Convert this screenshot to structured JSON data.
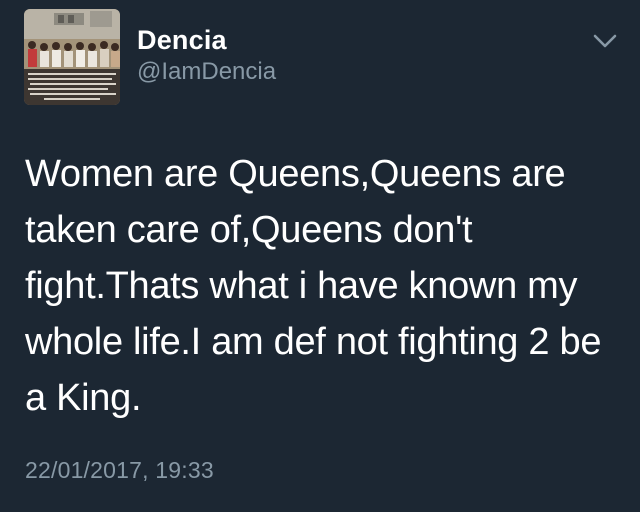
{
  "tweet": {
    "display_name": "Dencia",
    "handle": "@IamDencia",
    "text": "Women are Queens,Queens are taken care of,Queens don't fight.Thats what i have known my whole life.I am def not fighting 2 be a King.",
    "timestamp": "22/01/2017, 19:33",
    "avatar": "profile-photo",
    "menu_icon": "chevron-down-icon"
  },
  "colors": {
    "background": "#1c2733",
    "text_primary": "#ffffff",
    "text_secondary": "#8899a6"
  }
}
